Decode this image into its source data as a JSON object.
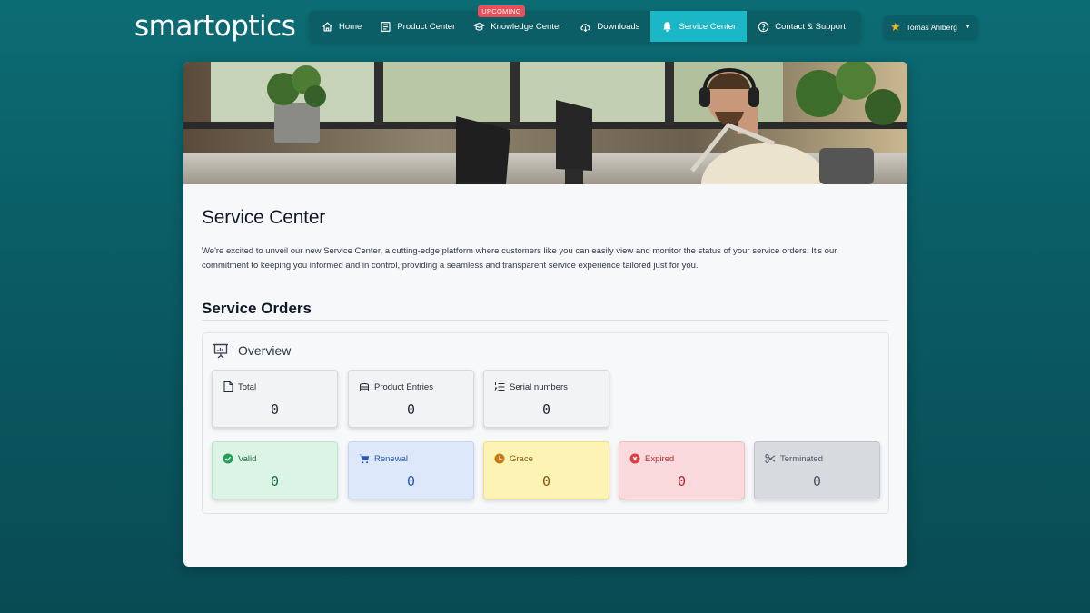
{
  "brand": {
    "logo_text": "smartoptics"
  },
  "nav": {
    "items": [
      {
        "label": "Home",
        "icon": "home-icon"
      },
      {
        "label": "Product Center",
        "icon": "catalog-icon"
      },
      {
        "label": "Knowledge Center",
        "icon": "graduation-cap-icon",
        "badge": "UPCOMING"
      },
      {
        "label": "Downloads",
        "icon": "cloud-download-icon"
      },
      {
        "label": "Service Center",
        "icon": "bell-icon",
        "active": true
      },
      {
        "label": "Contact & Support",
        "icon": "question-circle-icon"
      }
    ]
  },
  "user": {
    "name": "Tomas Ahlberg",
    "icon": "star-icon"
  },
  "page": {
    "title": "Service Center",
    "intro": "We're excited to unveil our new Service Center, a cutting-edge platform where customers like you can easily view and monitor the status of your service orders. It's our commitment to keeping you informed and in control, providing a seamless and transparent service experience tailored just for you."
  },
  "service_orders": {
    "title": "Service Orders",
    "overview_title": "Overview",
    "stats_row1": [
      {
        "label": "Total",
        "value": "0",
        "icon": "document-icon"
      },
      {
        "label": "Product Entries",
        "value": "0",
        "icon": "server-icon"
      },
      {
        "label": "Serial numbers",
        "value": "0",
        "icon": "list-numbered-icon"
      }
    ],
    "stats_row2": [
      {
        "label": "Valid",
        "value": "0",
        "icon": "check-circle-icon",
        "color": "#1f6b42"
      },
      {
        "label": "Renewal",
        "value": "0",
        "icon": "cart-icon",
        "color": "#2a56b8"
      },
      {
        "label": "Grace",
        "value": "0",
        "icon": "clock-icon",
        "color": "#8a5710"
      },
      {
        "label": "Expired",
        "value": "0",
        "icon": "x-circle-icon",
        "color": "#b42a2f"
      },
      {
        "label": "Terminated",
        "value": "0",
        "icon": "scissors-icon",
        "color": "#4b5563"
      }
    ]
  },
  "colors": {
    "background": "#0a5b63",
    "nav_bg": "#0b5e66",
    "nav_active": "#1bb7c6",
    "badge": "#e9505a",
    "accent_star": "#f5b81c"
  }
}
